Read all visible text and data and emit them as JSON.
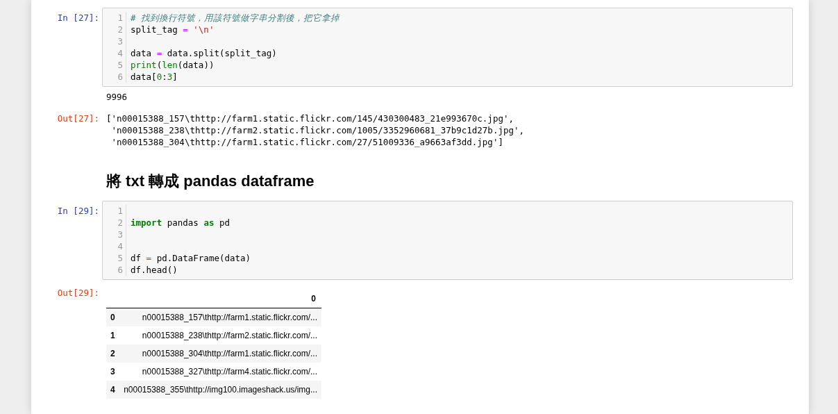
{
  "cells": [
    {
      "kind": "code",
      "prompt": "In [27]:",
      "lines": [
        {
          "number": "1",
          "tokens": [
            {
              "kind": "comment",
              "text": "# 找到換行符號，用該符號做字串分割後，把它拿掉"
            }
          ]
        },
        {
          "number": "2",
          "tokens": [
            {
              "kind": "plain",
              "text": "split_tag "
            },
            {
              "kind": "operator",
              "text": "="
            },
            {
              "kind": "string",
              "text": " '\\n'"
            }
          ]
        },
        {
          "number": "3"
        },
        {
          "number": "4",
          "tokens": [
            {
              "kind": "plain",
              "text": "data "
            },
            {
              "kind": "operator",
              "text": "="
            },
            {
              "kind": "plain",
              "text": " data.split(split_tag)"
            }
          ]
        },
        {
          "number": "5",
          "tokens": [
            {
              "kind": "builtin",
              "text": "print"
            },
            {
              "kind": "plain",
              "text": "("
            },
            {
              "kind": "builtin",
              "text": "len"
            },
            {
              "kind": "plain",
              "text": "(data))"
            }
          ]
        },
        {
          "number": "6",
          "tokens": [
            {
              "kind": "plain",
              "text": "data["
            },
            {
              "kind": "number",
              "text": "0"
            },
            {
              "kind": "plain",
              "text": ":"
            },
            {
              "kind": "number",
              "text": "3"
            },
            {
              "kind": "plain",
              "text": "]"
            }
          ]
        }
      ]
    },
    {
      "kind": "stream",
      "lines": [
        "9996"
      ]
    },
    {
      "kind": "result",
      "prompt": "Out[27]:",
      "lines": [
        "['n00015388_157\\thttp://farm1.static.flickr.com/145/430300483_21e993670c.jpg',",
        " 'n00015388_238\\thttp://farm2.static.flickr.com/1005/3352960681_37b9c1d27b.jpg',",
        " 'n00015388_304\\thttp://farm1.static.flickr.com/27/51009336_a9663af3dd.jpg']"
      ]
    },
    {
      "kind": "heading",
      "text": "將 txt 轉成 pandas dataframe"
    },
    {
      "kind": "code",
      "prompt": "In [29]:",
      "lines": [
        {
          "number": "1"
        },
        {
          "number": "2",
          "tokens": [
            {
              "kind": "keyword",
              "text": "import"
            },
            {
              "kind": "plain",
              "text": " pandas "
            },
            {
              "kind": "keyword",
              "text": "as"
            },
            {
              "kind": "plain",
              "text": " pd"
            }
          ]
        },
        {
          "number": "3"
        },
        {
          "number": "4"
        },
        {
          "number": "5",
          "tokens": [
            {
              "kind": "plain",
              "text": "df "
            },
            {
              "kind": "operator",
              "text": "="
            },
            {
              "kind": "plain",
              "text": " pd.DataFrame(data)"
            }
          ]
        },
        {
          "number": "6",
          "tokens": [
            {
              "kind": "plain",
              "text": "df.head()"
            }
          ]
        }
      ]
    },
    {
      "kind": "table",
      "prompt": "Out[29]:",
      "columns": [
        "0"
      ],
      "rows": [
        {
          "index": "0",
          "values": [
            "n00015388_157\\thttp://farm1.static.flickr.com/..."
          ]
        },
        {
          "index": "1",
          "values": [
            "n00015388_238\\thttp://farm2.static.flickr.com/..."
          ]
        },
        {
          "index": "2",
          "values": [
            "n00015388_304\\thttp://farm1.static.flickr.com/..."
          ]
        },
        {
          "index": "3",
          "values": [
            "n00015388_327\\thttp://farm4.static.flickr.com/..."
          ]
        },
        {
          "index": "4",
          "values": [
            "n00015388_355\\thttp://img100.imageshack.us/img..."
          ]
        }
      ]
    }
  ]
}
